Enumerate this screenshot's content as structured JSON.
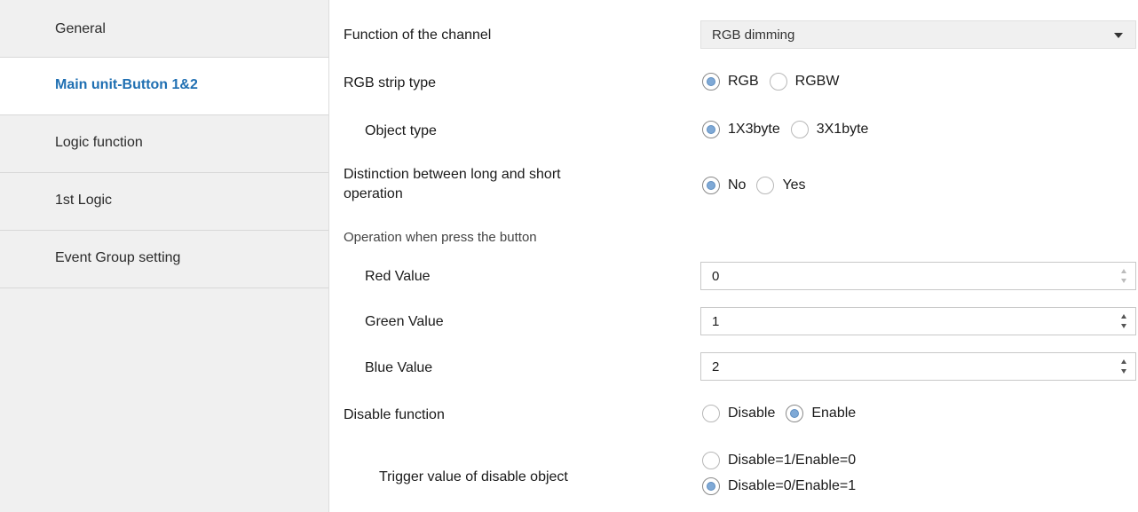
{
  "sidebar": {
    "items": [
      {
        "label": "General"
      },
      {
        "label": "Main unit-Button 1&2"
      },
      {
        "label": "Logic function"
      },
      {
        "label": "1st Logic"
      },
      {
        "label": "Event Group setting"
      }
    ],
    "active_index": 1
  },
  "params": {
    "function_channel": {
      "label": "Function of the channel",
      "value": "RGB dimming"
    },
    "strip_type": {
      "label": "RGB strip type",
      "options": [
        "RGB",
        "RGBW"
      ],
      "selected": "RGB"
    },
    "object_type": {
      "label": "Object type",
      "options": [
        "1X3byte",
        "3X1byte"
      ],
      "selected": "1X3byte"
    },
    "distinction": {
      "label_line1": "Distinction between long and short",
      "label_line2": "operation",
      "options": [
        "No",
        "Yes"
      ],
      "selected": "No"
    },
    "operation_heading": "Operation when press the button",
    "red": {
      "label": "Red Value",
      "value": "0"
    },
    "green": {
      "label": "Green Value",
      "value": "1"
    },
    "blue": {
      "label": "Blue Value",
      "value": "2"
    },
    "disable_function": {
      "label": "Disable function",
      "options": [
        "Disable",
        "Enable"
      ],
      "selected": "Enable"
    },
    "trigger_value": {
      "label": "Trigger value of disable object",
      "options": [
        "Disable=1/Enable=0",
        "Disable=0/Enable=1"
      ],
      "selected": "Disable=0/Enable=1"
    }
  },
  "colors": {
    "active_nav": "#1f6fb2",
    "radio_fill": "#7fa9d6",
    "sidebar_bg": "#f0f0f0"
  }
}
